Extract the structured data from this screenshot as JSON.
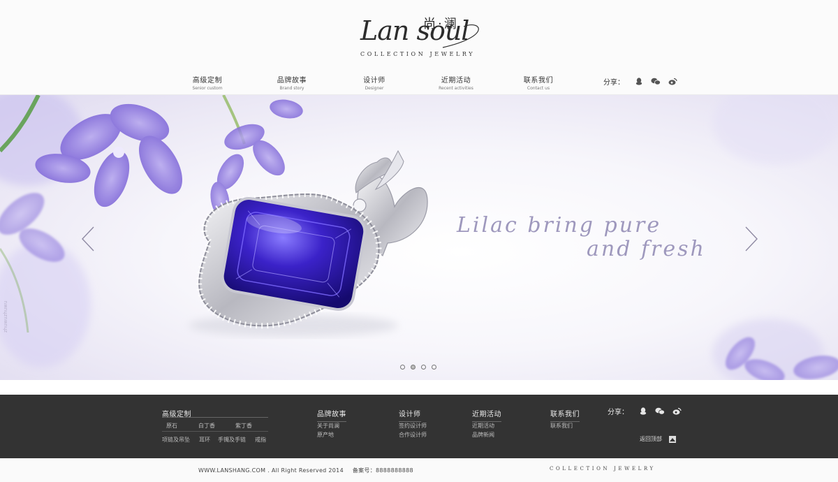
{
  "brand": {
    "logo_script": "Lan soul",
    "logo_cn": "尚·澜",
    "tagline": "COLLECTION  JEWELRY"
  },
  "nav": {
    "items": [
      {
        "cn": "高级定制",
        "en": "Senior custom"
      },
      {
        "cn": "品牌故事",
        "en": "Brand story"
      },
      {
        "cn": "设计师",
        "en": "Designer"
      },
      {
        "cn": "近期活动",
        "en": "Recent activities"
      },
      {
        "cn": "联系我们",
        "en": "Contact us"
      }
    ],
    "share_label": "分享："
  },
  "icons": {
    "share": [
      "qq-icon",
      "wechat-icon",
      "weibo-icon"
    ],
    "arrows": [
      "chevron-left-icon",
      "chevron-right-icon"
    ],
    "back_top": "arrow-up-icon"
  },
  "banner": {
    "slogan_line1": "Lilac bring pure",
    "slogan_line2": "and fresh",
    "slide_count": 4,
    "active_slide": 2,
    "watermark": "zhuwuzhuwu"
  },
  "colors": {
    "footer_bg": "#333333",
    "slogan": "#9e98bd",
    "gem": "#2a1aa8"
  },
  "footer": {
    "custom": {
      "title": "高级定制",
      "links": [
        "原石",
        "白丁香",
        "紫丁香",
        "项链及吊坠",
        "耳环",
        "手镯及手链",
        "戒指"
      ]
    },
    "brand": {
      "title": "品牌故事",
      "links": [
        "关于尚澜",
        "原产地"
      ]
    },
    "designer": {
      "title": "设计师",
      "links": [
        "签约设计师",
        "合作设计师"
      ]
    },
    "events": {
      "title": "近期活动",
      "links": [
        "近期活动",
        "品牌新闻"
      ]
    },
    "contact": {
      "title": "联系我们",
      "links": [
        "联系我们"
      ]
    },
    "share_label": "分享：",
    "back_top": "返回顶部"
  },
  "bottom": {
    "copyright": "WWW.LANSHANG.COM . All Right Reserved 2014",
    "icp": "备案号：8888888888",
    "tagline": "COLLECTION  JEWELRY"
  }
}
